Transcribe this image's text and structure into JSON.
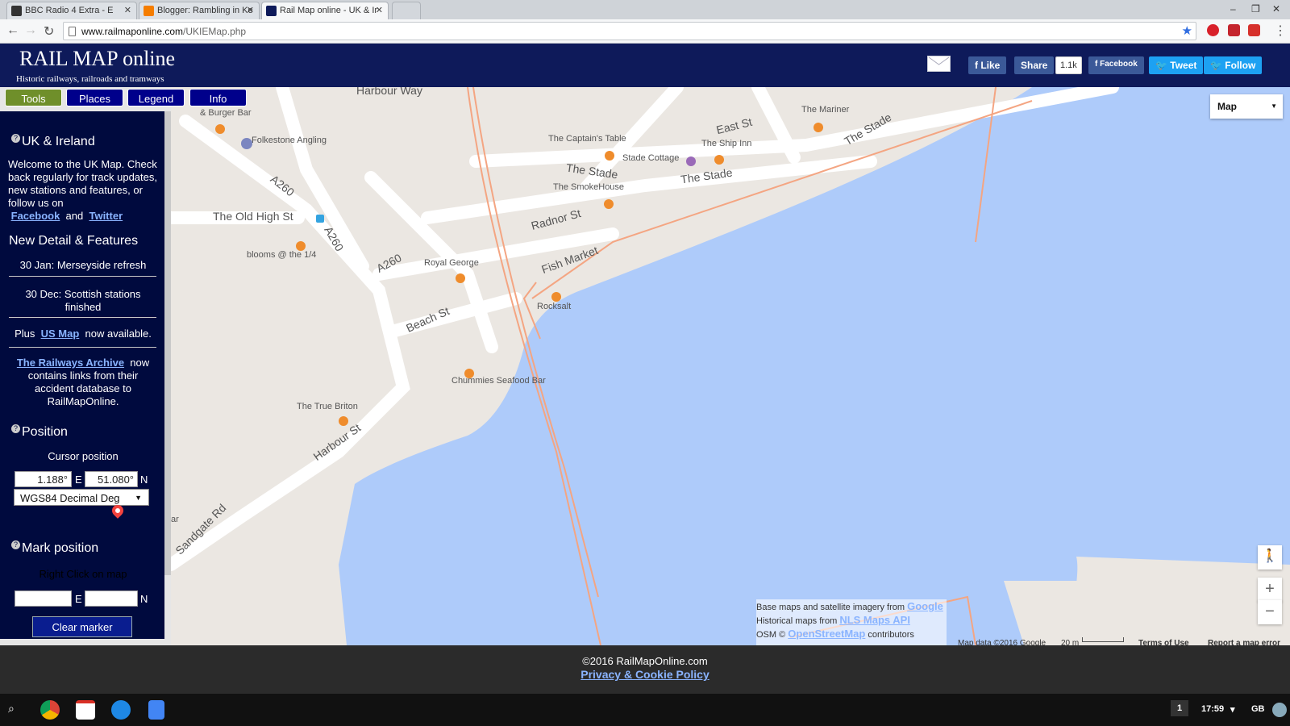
{
  "browser": {
    "tabs": [
      {
        "title": "BBC Radio 4 Extra - E"
      },
      {
        "title": "Blogger: Rambling in Ke"
      },
      {
        "title": "Rail Map online - UK & Ir"
      }
    ],
    "url_host": "www.railmaponline.com",
    "url_path": "/UKIEMap.php",
    "window_controls": {
      "minimize": "–",
      "restore": "❐",
      "close": "✕"
    }
  },
  "site": {
    "title": "RAIL MAP online",
    "subtitle": "Historic railways, railroads and tramways"
  },
  "social": {
    "like": "Like",
    "share": "Share",
    "share_count": "1.1k",
    "find_us": "Facebook",
    "tweet": "Tweet",
    "follow": "Follow"
  },
  "menu": {
    "tools": "Tools",
    "places": "Places",
    "legend": "Legend",
    "info": "Info"
  },
  "panel": {
    "heading_uk": "UK & Ireland",
    "welcome_text": "Welcome to the UK Map. Check back regularly for track updates, new stations and features, or follow us on",
    "link_facebook": "Facebook",
    "and": "and",
    "link_twitter": "Twitter",
    "heading_news": "New Detail & Features",
    "news_1": "30 Jan: Merseyside refresh",
    "news_2": "30 Dec: Scottish stations finished",
    "plus": "Plus",
    "us_map": "US Map",
    "now_available": "now available.",
    "railways_archive": "The Railways Archive",
    "now": "now",
    "archive_text": "contains links from their accident database to RailMapOnline.",
    "heading_position": "Position",
    "cursor_position": "Cursor position",
    "lon": "1.188°",
    "lat": "51.080°",
    "e": "E",
    "n": "N",
    "format": "WGS84 Decimal Deg",
    "heading_mark": "Mark position",
    "right_click": "Right Click on map",
    "clear_marker": "Clear marker"
  },
  "map": {
    "type_selected": "Map",
    "zoom_in": "+",
    "zoom_out": "−",
    "labels": {
      "harbour_way": "Harbour Way",
      "east_st": "East St",
      "the_stade_top": "The Stade",
      "the_stade_mid": "The Stade",
      "the_stade_right": "The Stade",
      "a260_1": "A260",
      "a260_2": "A260",
      "a260_3": "A260",
      "old_high_st": "The Old High St",
      "radnor_st": "Radnor St",
      "fish_market": "Fish Market",
      "beach_st": "Beach St",
      "harbour_st": "Harbour St",
      "sandgate_rd": "Sandgate Rd",
      "burger_bar": "& Burger Bar",
      "folkestone_angling": "Folkestone Angling",
      "captains_table": "The Captain's Table",
      "stade_cottage": "Stade Cottage",
      "ship_inn": "The Ship Inn",
      "mariner": "The Mariner",
      "smokehouse": "The SmokeHouse",
      "blooms": "blooms @ the 1/4",
      "royal_george": "Royal George",
      "rocksalt": "Rocksalt",
      "chummies": "Chummies Seafood Bar",
      "true_briton": "The True Briton",
      "ar": "ar"
    },
    "attribution": {
      "base": "Base maps and satellite imagery from",
      "google": "Google",
      "historical": "Historical maps from",
      "nls": "NLS Maps API",
      "osm": "OSM ©",
      "openstreetmap": "OpenStreetMap",
      "contributors": "contributors"
    },
    "google_bar": {
      "data": "Map data ©2016 Google",
      "scale": "20 m",
      "terms": "Terms of Use",
      "report": "Report a map error"
    }
  },
  "footer": {
    "copyright": "©2016 RailMapOnline.com",
    "privacy": "Privacy & Cookie Policy"
  },
  "taskbar": {
    "workspace": "1",
    "time": "17:59",
    "lang": "GB"
  },
  "colors": {
    "header_bg": "#0e1a5a",
    "panel_bg": "#000a3e",
    "tools_green": "#6f8f2a",
    "water": "#aecbfa",
    "rail": "#f4a582"
  }
}
